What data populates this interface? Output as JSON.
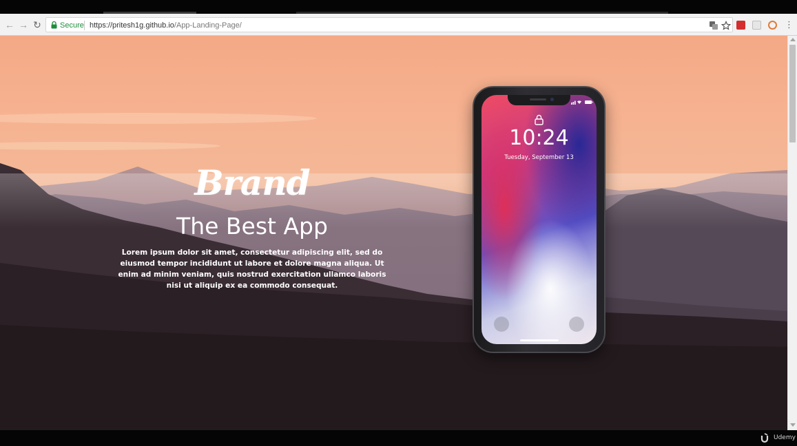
{
  "browser": {
    "secure_label": "Secure",
    "url_host": "https://pritesh1g.github.io",
    "url_path": "/App-Landing-Page/"
  },
  "hero": {
    "brand": "Brand",
    "headline": "The Best App",
    "body": "Lorem ipsum dolor sit amet, consectetur adipiscing elit, sed do eiusmod tempor incididunt ut labore et dolore magna aliqua. Ut enim ad minim veniam, quis nostrud exercitation ullamco laboris nisi ut aliquip ex ea commodo consequat."
  },
  "phone": {
    "time": "10:24",
    "date": "Tuesday, September 13"
  },
  "watermark": {
    "text": "Udemy"
  },
  "icons": {
    "back": "back-arrow-icon",
    "forward": "forward-arrow-icon",
    "reload": "reload-icon",
    "lock": "padlock-icon",
    "translate": "translate-icon",
    "bookmark": "star-icon",
    "menu": "more-vertical-icon"
  },
  "colors": {
    "secure_green": "#1e8e3e",
    "sky_top": "#f4a985",
    "mountain_dark": "#2b2025"
  }
}
